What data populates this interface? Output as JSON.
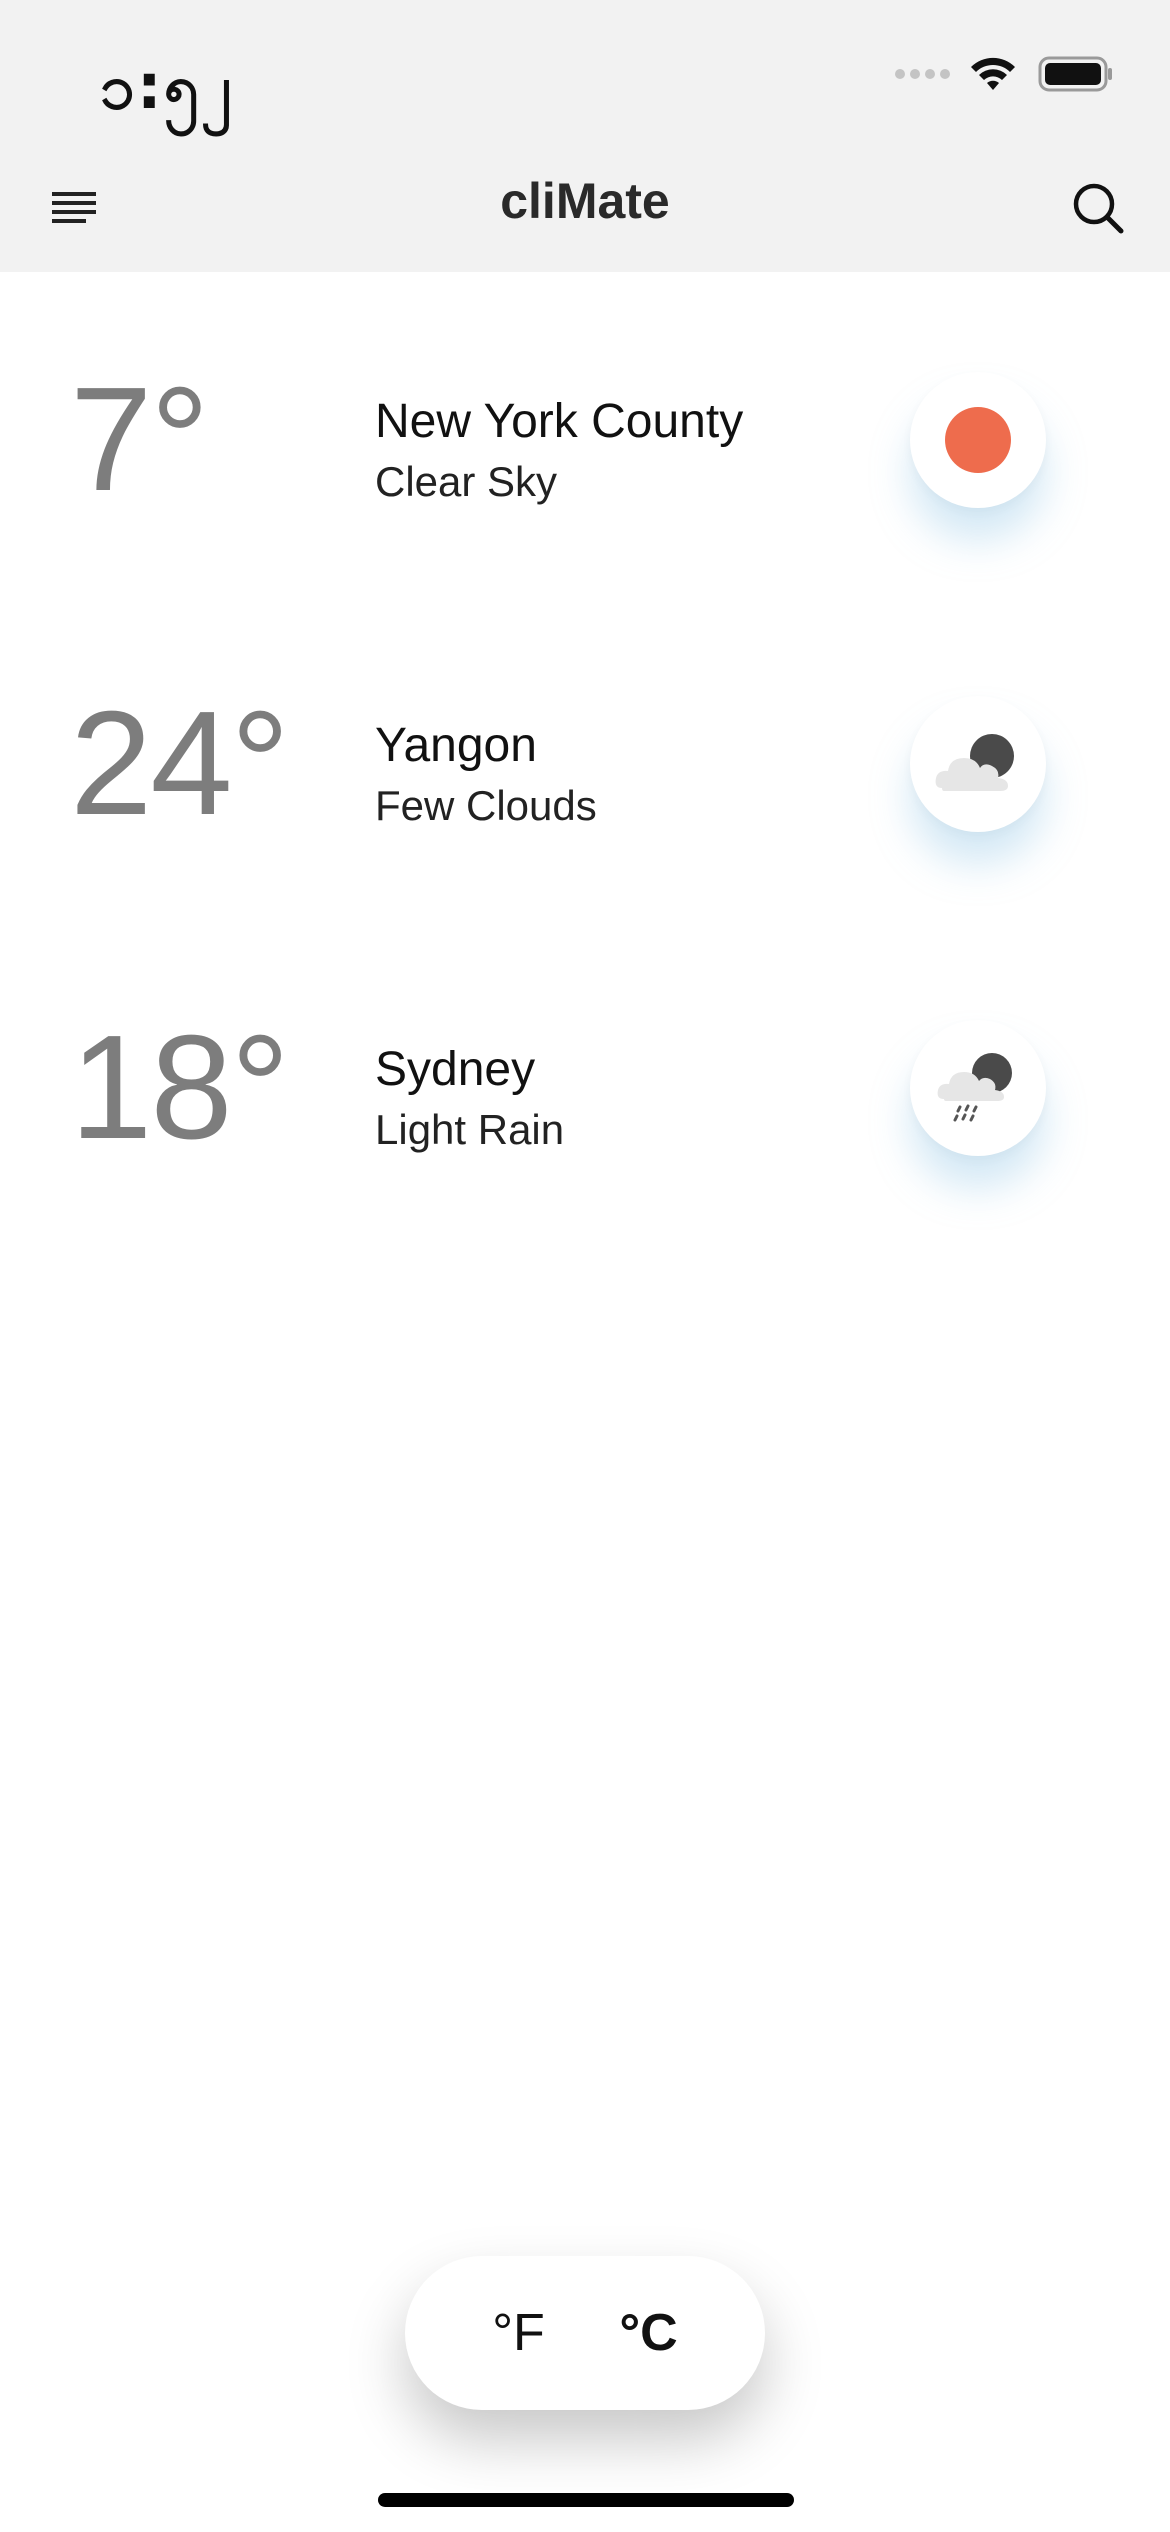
{
  "status_bar": {
    "time": "၁:၅၂"
  },
  "nav": {
    "title": "cliMate",
    "menu_icon": "menu-lines-icon",
    "search_icon": "search-icon"
  },
  "cities": [
    {
      "temp": "7°",
      "name": "New York County",
      "condition": "Clear Sky",
      "icon": "clear-sky-icon"
    },
    {
      "temp": "24°",
      "name": "Yangon",
      "condition": "Few Clouds",
      "icon": "few-clouds-icon"
    },
    {
      "temp": "18°",
      "name": "Sydney",
      "condition": "Light Rain",
      "icon": "light-rain-icon"
    }
  ],
  "units": {
    "fahrenheit": "°F",
    "celsius": "°C",
    "selected": "celsius"
  },
  "colors": {
    "sun": "#EE6C4D",
    "cloud": "#E6E6E6",
    "moon": "#4A4A4A",
    "temp_text": "#7D7D7D",
    "header_bg": "#F2F2F2"
  }
}
